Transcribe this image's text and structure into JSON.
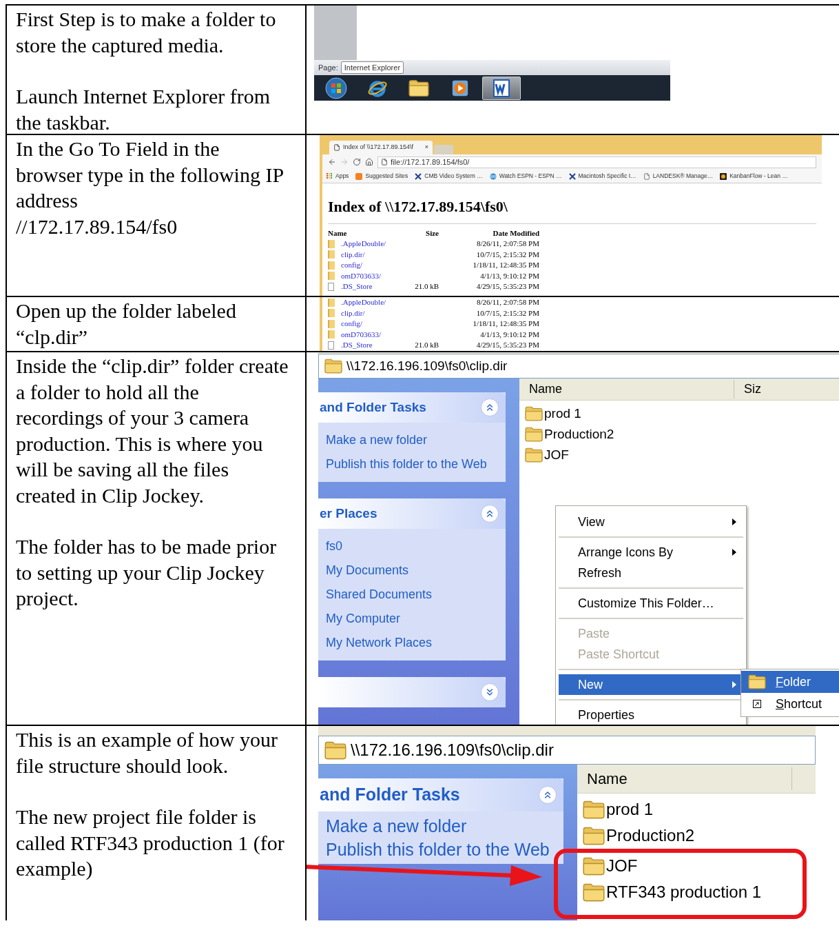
{
  "steps": [
    {
      "paragraphs": [
        [
          "First Step is to make a folder to store the captured media."
        ],
        [
          "Launch Internet Explorer from the taskbar."
        ]
      ],
      "screen": {
        "kind": "taskbar",
        "status_label": "Page:",
        "tooltip": "Internet Explorer",
        "taskbar_items": [
          {
            "kind": "start",
            "selected": false
          },
          {
            "kind": "browser",
            "selected": false
          },
          {
            "kind": "folder",
            "selected": false
          },
          {
            "kind": "media",
            "selected": false
          },
          {
            "kind": "document",
            "selected": true
          }
        ]
      }
    },
    {
      "paragraphs": [
        [
          "In the Go To Field in the browser type in the following IP address",
          "//172.17.89.154/fs0"
        ]
      ],
      "screen": {
        "kind": "browser",
        "tab_title": "Index of \\\\172.17.89.154\\f",
        "tab_close": "×",
        "address": "file://172.17.89.154/fs0/",
        "bookmarks": [
          {
            "kind": "apps",
            "label": "Apps"
          },
          {
            "kind": "suggested",
            "label": "Suggested Sites"
          },
          {
            "kind": "tool",
            "label": "CMB Video System …"
          },
          {
            "kind": "globe",
            "label": "Watch ESPN - ESPN …"
          },
          {
            "kind": "tool",
            "label": "Macintosh Specific I…"
          },
          {
            "kind": "page",
            "label": "LANDESK® Manage…"
          },
          {
            "kind": "flow",
            "label": "KanbanFlow - Lean …"
          }
        ],
        "heading": "Index of \\\\172.17.89.154\\fs0\\",
        "columns": [
          "Name",
          "Size",
          "Date Modified"
        ],
        "rows": [
          {
            "kind": "folder",
            "name": ".AppleDouble/",
            "date": "8/26/11, 2:07:58 PM"
          },
          {
            "kind": "folder",
            "name": "clip.dir/",
            "date": "10/7/15, 2:15:32 PM"
          },
          {
            "kind": "folder",
            "name": "config/",
            "date": "1/18/11, 12:48:35 PM"
          },
          {
            "kind": "folder",
            "name": "omD703633/",
            "date": "4/1/13, 9:10:12 PM"
          },
          {
            "kind": "file",
            "name": ".DS_Store",
            "size": "21.0 kB",
            "date": "4/29/15, 5:35:23 PM"
          }
        ]
      }
    },
    {
      "paragraphs": [
        [
          "Open up the folder labeled “clp.dir”"
        ]
      ],
      "screen": {
        "kind": "listing",
        "rows": [
          {
            "kind": "folder",
            "name": ".AppleDouble/",
            "date": "8/26/11, 2:07:58 PM"
          },
          {
            "kind": "folder",
            "name": "clip.dir/",
            "date": "10/7/15, 2:15:32 PM"
          },
          {
            "kind": "folder",
            "name": "config/",
            "date": "1/18/11, 12:48:35 PM"
          },
          {
            "kind": "folder",
            "name": "omD703633/",
            "date": "4/1/13, 9:10:12 PM"
          },
          {
            "kind": "file",
            "name": ".DS_Store",
            "size": "21.0 kB",
            "date": "4/29/15, 5:35:23 PM"
          }
        ]
      }
    },
    {
      "paragraphs": [
        [
          "Inside the “clip.dir” folder create a folder to hold all the recordings of your 3 camera production.  This is where you will be saving all the files created in Clip Jockey."
        ],
        [
          "The folder has to be made prior to setting up your Clip Jockey project."
        ]
      ],
      "screen": {
        "kind": "explorer_menu",
        "address": "\\\\172.16.196.109\\fs0\\clip.dir",
        "panels": [
          {
            "title": "and Folder Tasks",
            "expanded": true,
            "links": [
              "Make a new folder",
              "Publish this folder to the Web"
            ]
          },
          {
            "title": "er Places",
            "expanded": true,
            "links": [
              "fs0",
              "My Documents",
              "Shared Documents",
              "My Computer",
              "My Network Places"
            ]
          },
          {
            "expanded": false
          }
        ],
        "columns": [
          "Name",
          "Siz"
        ],
        "files": [
          {
            "name": "prod 1",
            "highlighted": false
          },
          {
            "name": "Production2",
            "highlighted": false
          },
          {
            "name": "JOF",
            "highlighted": false
          }
        ],
        "context_menu": {
          "groups": [
            {
              "items": [
                {
                  "label": "View",
                  "submenu": true,
                  "selected": false,
                  "disabled": false
                }
              ]
            },
            {
              "items": [
                {
                  "label": "Arrange Icons By",
                  "submenu": true,
                  "selected": false,
                  "disabled": false
                },
                {
                  "label": "Refresh",
                  "submenu": false,
                  "selected": false,
                  "disabled": false
                }
              ]
            },
            {
              "items": [
                {
                  "label": "Customize This Folder…",
                  "submenu": false,
                  "selected": false,
                  "disabled": false
                }
              ]
            },
            {
              "items": [
                {
                  "label": "Paste",
                  "submenu": false,
                  "selected": false,
                  "disabled": true
                },
                {
                  "label": "Paste Shortcut",
                  "submenu": false,
                  "selected": false,
                  "disabled": true
                }
              ]
            },
            {
              "items": [
                {
                  "label": "New",
                  "submenu": true,
                  "selected": true,
                  "disabled": false
                }
              ]
            },
            {
              "items": [
                {
                  "label": "Properties",
                  "submenu": false,
                  "selected": false,
                  "disabled": false
                }
              ]
            }
          ]
        },
        "submenu": [
          {
            "kind": "folder",
            "label": "Folder",
            "selected": true
          },
          {
            "kind": "shortcut",
            "label": "Shortcut",
            "selected": false
          }
        ]
      }
    },
    {
      "paragraphs": [
        [
          "This is an example of how your file structure should look."
        ],
        [
          "The new project file folder is called RTF343 production  1 (for example)"
        ]
      ],
      "screen": {
        "kind": "explorer_example",
        "address": "\\\\172.16.196.109\\fs0\\clip.dir",
        "panels": [
          {
            "title": "and Folder Tasks",
            "expanded": true,
            "links": [
              "Make a new folder",
              "Publish this folder to the Web"
            ]
          }
        ],
        "columns": [
          "Name"
        ],
        "files": [
          {
            "name": "prod 1",
            "highlighted": false
          },
          {
            "name": "Production2",
            "highlighted": false
          },
          {
            "name": "JOF",
            "highlighted": true
          },
          {
            "name": "RTF343 production 1",
            "highlighted": true
          }
        ]
      }
    }
  ]
}
